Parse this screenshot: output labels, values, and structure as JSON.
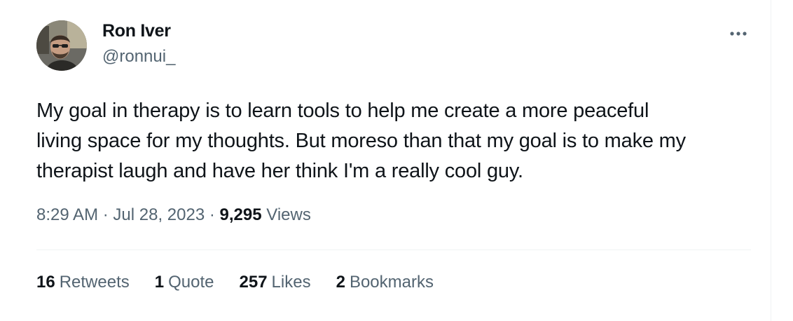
{
  "author": {
    "display_name": "Ron Iver",
    "handle": "@ronnui_",
    "avatar_icon": "user-avatar-photo"
  },
  "tweet": {
    "lines": [
      "My goal in therapy is to learn tools to help me create a more peaceful",
      "living space for my thoughts. But moreso than that my goal is to make my",
      "therapist laugh and have her think I'm a really cool guy."
    ]
  },
  "meta": {
    "time": "8:29 AM",
    "separator": "·",
    "date": "Jul 28, 2023",
    "views_count": "9,295",
    "views_label": "Views"
  },
  "stats": [
    {
      "count": "16",
      "label": "Retweets"
    },
    {
      "count": "1",
      "label": "Quote"
    },
    {
      "count": "257",
      "label": "Likes"
    },
    {
      "count": "2",
      "label": "Bookmarks"
    }
  ],
  "colors": {
    "primary_text": "#0f1419",
    "secondary_text": "#536471",
    "divider": "#eff3f4"
  },
  "more_icon": "more-horizontal-icon"
}
